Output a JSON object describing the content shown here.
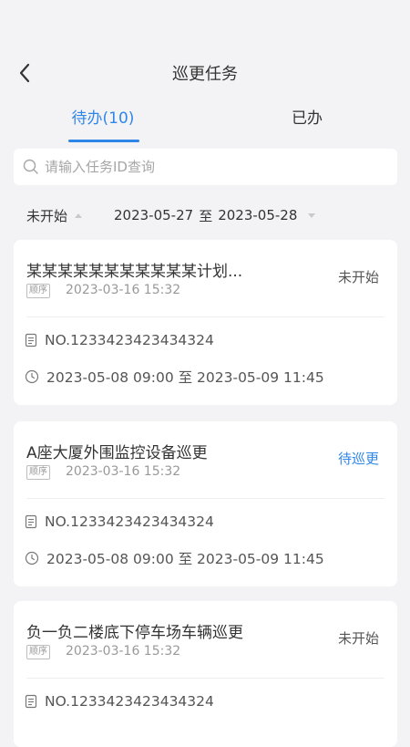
{
  "header": {
    "title": "巡更任务",
    "back_icon": "chevron-left-icon"
  },
  "tabs": [
    {
      "label": "待办(10)",
      "active": true
    },
    {
      "label": "已办",
      "active": false
    }
  ],
  "search": {
    "placeholder": "请输入任务ID查询",
    "value": ""
  },
  "filters": {
    "status": "未开始",
    "date_start": "2023-05-27",
    "date_sep": "至",
    "date_end": "2023-05-28"
  },
  "tasks": [
    {
      "name": "某某某某某某某某某某某计划...",
      "tag": "顺序",
      "created": "2023-03-16 15:32",
      "status": "未开始",
      "no": "NO.1233423423434324",
      "time": "2023-05-08 09:00 至 2023-05-09 11:45"
    },
    {
      "name": "A座大厦外围监控设备巡更",
      "tag": "顺序",
      "created": "2023-03-16 15:32",
      "status": "待巡更",
      "no": "NO.1233423423434324",
      "time": "2023-05-08 09:00 至 2023-05-09 11:45"
    },
    {
      "name": "负一负二楼底下停车场车辆巡更",
      "tag": "顺序",
      "created": "2023-03-16 15:32",
      "status": "未开始",
      "no": "NO.1233423423434324",
      "time": ""
    }
  ],
  "colors": {
    "accent": "#2f86e8",
    "background": "#f3f3f5"
  }
}
